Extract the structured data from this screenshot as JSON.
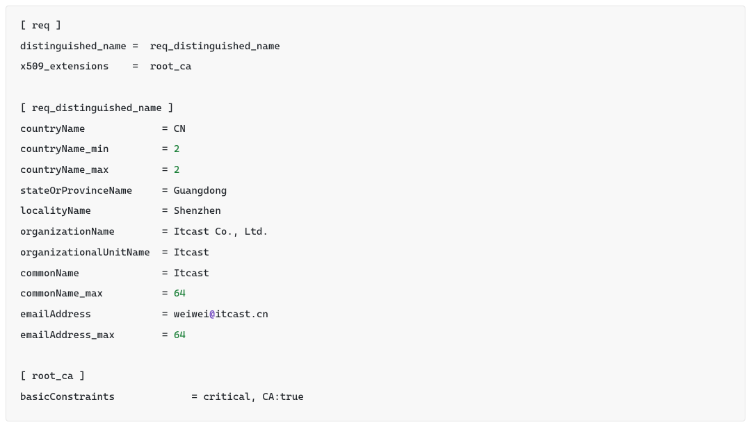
{
  "config": {
    "sections": [
      {
        "header": "[ req ]",
        "entries": [
          {
            "key": "distinguished_name",
            "keyPad": 19,
            "equalsPad": "  ",
            "value": "req_distinguished_name",
            "valueType": "plain"
          },
          {
            "key": "x509_extensions",
            "keyPad": 19,
            "equalsPad": "  ",
            "value": "root_ca",
            "valueType": "plain"
          }
        ]
      },
      {
        "header": "[ req_distinguished_name ]",
        "entries": [
          {
            "key": "countryName",
            "keyPad": 24,
            "equalsPad": " ",
            "value": "CN",
            "valueType": "plain"
          },
          {
            "key": "countryName_min",
            "keyPad": 24,
            "equalsPad": " ",
            "value": "2",
            "valueType": "number"
          },
          {
            "key": "countryName_max",
            "keyPad": 24,
            "equalsPad": " ",
            "value": "2",
            "valueType": "number"
          },
          {
            "key": "stateOrProvinceName",
            "keyPad": 24,
            "equalsPad": " ",
            "value": "Guangdong",
            "valueType": "plain"
          },
          {
            "key": "localityName",
            "keyPad": 24,
            "equalsPad": " ",
            "value": "Shenzhen",
            "valueType": "plain"
          },
          {
            "key": "organizationName",
            "keyPad": 24,
            "equalsPad": " ",
            "value": "Itcast Co., Ltd.",
            "valueType": "plain"
          },
          {
            "key": "organizationalUnitName",
            "keyPad": 24,
            "equalsPad": " ",
            "value": "Itcast",
            "valueType": "plain"
          },
          {
            "key": "commonName",
            "keyPad": 24,
            "equalsPad": " ",
            "value": "Itcast",
            "valueType": "plain"
          },
          {
            "key": "commonName_max",
            "keyPad": 24,
            "equalsPad": " ",
            "value": "64",
            "valueType": "number"
          },
          {
            "key": "emailAddress",
            "keyPad": 24,
            "equalsPad": " ",
            "value": "weiwei@itcast.cn",
            "valueType": "email"
          },
          {
            "key": "emailAddress_max",
            "keyPad": 24,
            "equalsPad": " ",
            "value": "64",
            "valueType": "number"
          }
        ]
      },
      {
        "header": "[ root_ca ]",
        "entries": [
          {
            "key": "basicConstraints",
            "keyPad": 29,
            "equalsPad": " ",
            "value": "critical, CA:true",
            "valueType": "plain"
          }
        ]
      }
    ]
  }
}
